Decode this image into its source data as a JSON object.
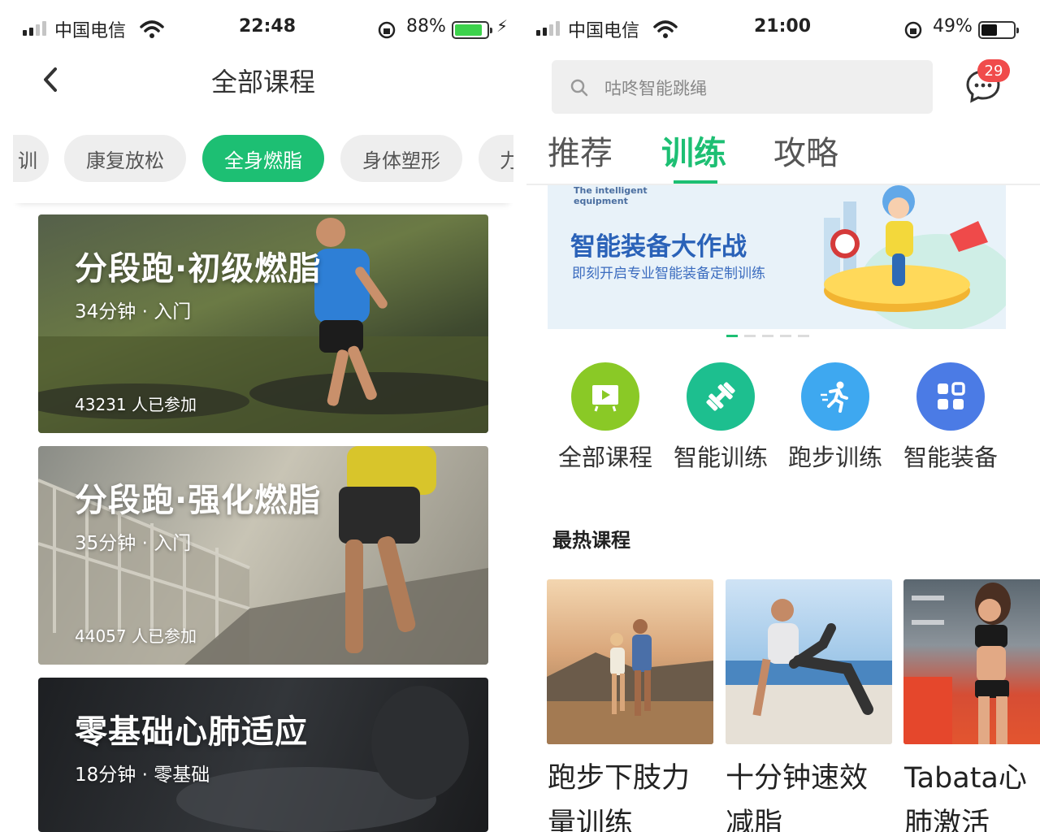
{
  "left": {
    "status": {
      "carrier": "中国电信",
      "time": "22:48",
      "battery": "88%",
      "battery_level": 0.88
    },
    "header": {
      "title": "全部课程"
    },
    "filters": [
      {
        "label": "训"
      },
      {
        "label": "康复放松"
      },
      {
        "label": "全身燃脂",
        "active": true
      },
      {
        "label": "身体塑形"
      },
      {
        "label": "力"
      }
    ],
    "courses": [
      {
        "title": "分段跑·初级燃脂",
        "meta": "34分钟 · 入门",
        "joined": "43231 人已参加"
      },
      {
        "title": "分段跑·强化燃脂",
        "meta": "35分钟 · 入门",
        "joined": "44057 人已参加"
      },
      {
        "title": "零基础心肺适应",
        "meta": "18分钟 · 零基础"
      }
    ]
  },
  "right": {
    "status": {
      "carrier": "中国电信",
      "time": "21:00",
      "battery": "49%",
      "battery_level": 0.49
    },
    "search": {
      "placeholder": "咕咚智能跳绳"
    },
    "messages": {
      "badge": "29"
    },
    "tabs": [
      {
        "label": "推荐"
      },
      {
        "label": "训练",
        "active": true
      },
      {
        "label": "攻略"
      }
    ],
    "banner": {
      "small_text": "The intelligent equipment",
      "title": "智能装备大作战",
      "subtitle": "即刻开启专业智能装备定制训练",
      "page_count": 5,
      "active_page": 1
    },
    "categories": [
      {
        "label": "全部课程",
        "icon": "play-board-icon",
        "color": "#8ac926"
      },
      {
        "label": "智能训练",
        "icon": "dumbbell-icon",
        "color": "#1dbf8f"
      },
      {
        "label": "跑步训练",
        "icon": "runner-icon",
        "color": "#3ea8f0"
      },
      {
        "label": "智能装备",
        "icon": "grid-icon",
        "color": "#4b7be5"
      }
    ],
    "section": {
      "title": "最热课程"
    },
    "hot_courses": [
      {
        "title": "跑步下肢力量训练"
      },
      {
        "title": "十分钟速效减脂"
      },
      {
        "title": "Tabata心肺激活"
      }
    ]
  },
  "colors": {
    "accent": "#1dbf73",
    "badge": "#f04b4b"
  }
}
